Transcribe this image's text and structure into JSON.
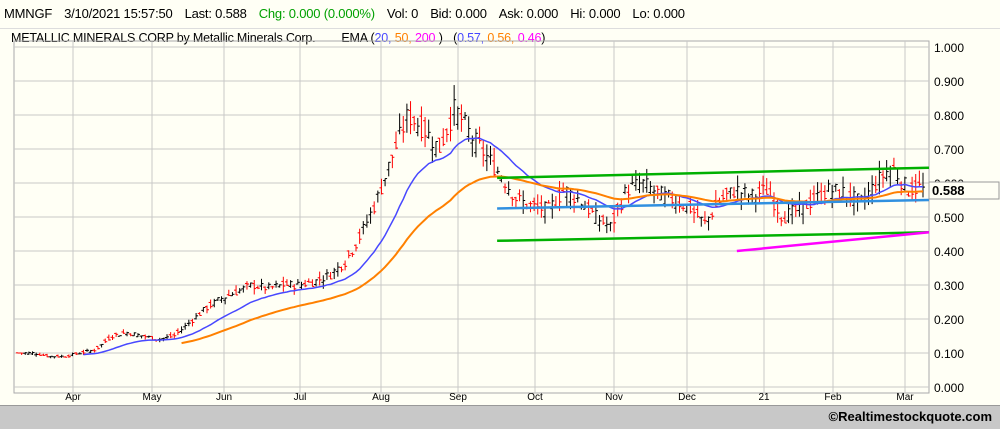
{
  "quote": {
    "symbol": "MMNGF",
    "datetime": "3/10/2021 15:57:50",
    "last": "Last: 0.588",
    "chg": "Chg: 0.000 (0.000%)",
    "vol": "Vol: 0",
    "bid": "Bid: 0.000",
    "ask": "Ask: 0.000",
    "hi": "Hi: 0.000",
    "lo": "Lo: 0.000"
  },
  "header": {
    "company": "METALLIC MINERALS CORP by Metallic Minerals Corp.",
    "ema_label": "EMA (",
    "p20": "20,",
    "p50": "50,",
    "p200": "200",
    "close_paren": ")",
    "open2": "(",
    "v20": "0.57,",
    "v50": "0.56,",
    "v200": "0.46",
    "close2": ")"
  },
  "footer": {
    "copyright": "©Realtimestockquote.com"
  },
  "colors": {
    "ema20": "#4848ff",
    "ema50": "#ff8000",
    "ema200": "#ff00ff",
    "channel": "#00b000",
    "midline": "#3090e0",
    "up": "#000000",
    "down": "#ff0000",
    "grid": "#c8c8c8"
  },
  "chart_data": {
    "type": "ohlc",
    "ylim": [
      0,
      1
    ],
    "yticks": [
      "0.000",
      "0.100",
      "0.200",
      "0.300",
      "0.400",
      "0.500",
      "0.600",
      "0.700",
      "0.800",
      "0.900",
      "1.000"
    ],
    "xticks": [
      "Apr",
      "May",
      "Jun",
      "Jul",
      "Aug",
      "Sep",
      "Oct",
      "Nov",
      "Dec",
      "21",
      "Feb",
      "Mar"
    ],
    "last_price_label": "0.588",
    "weekly_closes": [
      0.1,
      0.1,
      0.09,
      0.09,
      0.1,
      0.11,
      0.15,
      0.16,
      0.15,
      0.14,
      0.15,
      0.19,
      0.23,
      0.26,
      0.28,
      0.3,
      0.29,
      0.3,
      0.3,
      0.31,
      0.33,
      0.37,
      0.45,
      0.55,
      0.68,
      0.8,
      0.76,
      0.7,
      0.82,
      0.74,
      0.68,
      0.62,
      0.55,
      0.53,
      0.52,
      0.58,
      0.55,
      0.5,
      0.47,
      0.58,
      0.6,
      0.57,
      0.55,
      0.53,
      0.48,
      0.55,
      0.58,
      0.56,
      0.58,
      0.5,
      0.52,
      0.55,
      0.58,
      0.57,
      0.54,
      0.6,
      0.65,
      0.58,
      0.588
    ],
    "trendlines": [
      {
        "name": "upper-channel",
        "from": [
          0.528,
          0.615
        ],
        "to": [
          1.0,
          0.645
        ]
      },
      {
        "name": "lower-channel",
        "from": [
          0.528,
          0.43
        ],
        "to": [
          1.0,
          0.455
        ]
      },
      {
        "name": "midline",
        "from": [
          0.528,
          0.525
        ],
        "to": [
          1.0,
          0.55
        ]
      },
      {
        "name": "ema200",
        "from": [
          0.79,
          0.4
        ],
        "to": [
          1.0,
          0.455
        ]
      }
    ]
  }
}
